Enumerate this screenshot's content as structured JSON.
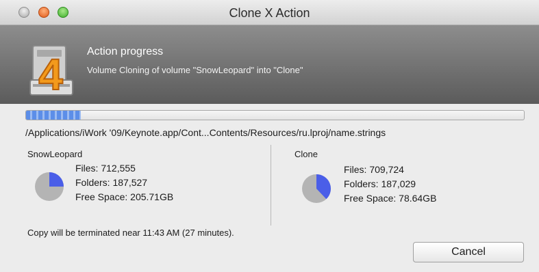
{
  "window": {
    "title": "Clone X Action"
  },
  "header": {
    "title": "Action progress",
    "subtitle": "Volume Cloning of volume \"SnowLeopard\" into \"Clone\"",
    "icon_digit": "4"
  },
  "progress": {
    "fraction": 0.11
  },
  "current_path": "/Applications/iWork '09/Keynote.app/Cont...Contents/Resources/ru.lproj/name.strings",
  "source": {
    "name": "SnowLeopard",
    "files": "Files: 712,555",
    "folders": "Folders: 187,527",
    "free_space": "Free Space: 205.71GB",
    "used_fraction": 0.25
  },
  "destination": {
    "name": "Clone",
    "files": "Files: 709,724",
    "folders": "Folders: 187,029",
    "free_space": "Free Space: 78.64GB",
    "used_fraction": 0.38
  },
  "status_text": "Copy will be terminated near 11:43 AM (27 minutes).",
  "buttons": {
    "cancel": "Cancel"
  },
  "colors": {
    "pie_fill": "#4a5ee8",
    "pie_base": "#b4b4b4"
  }
}
